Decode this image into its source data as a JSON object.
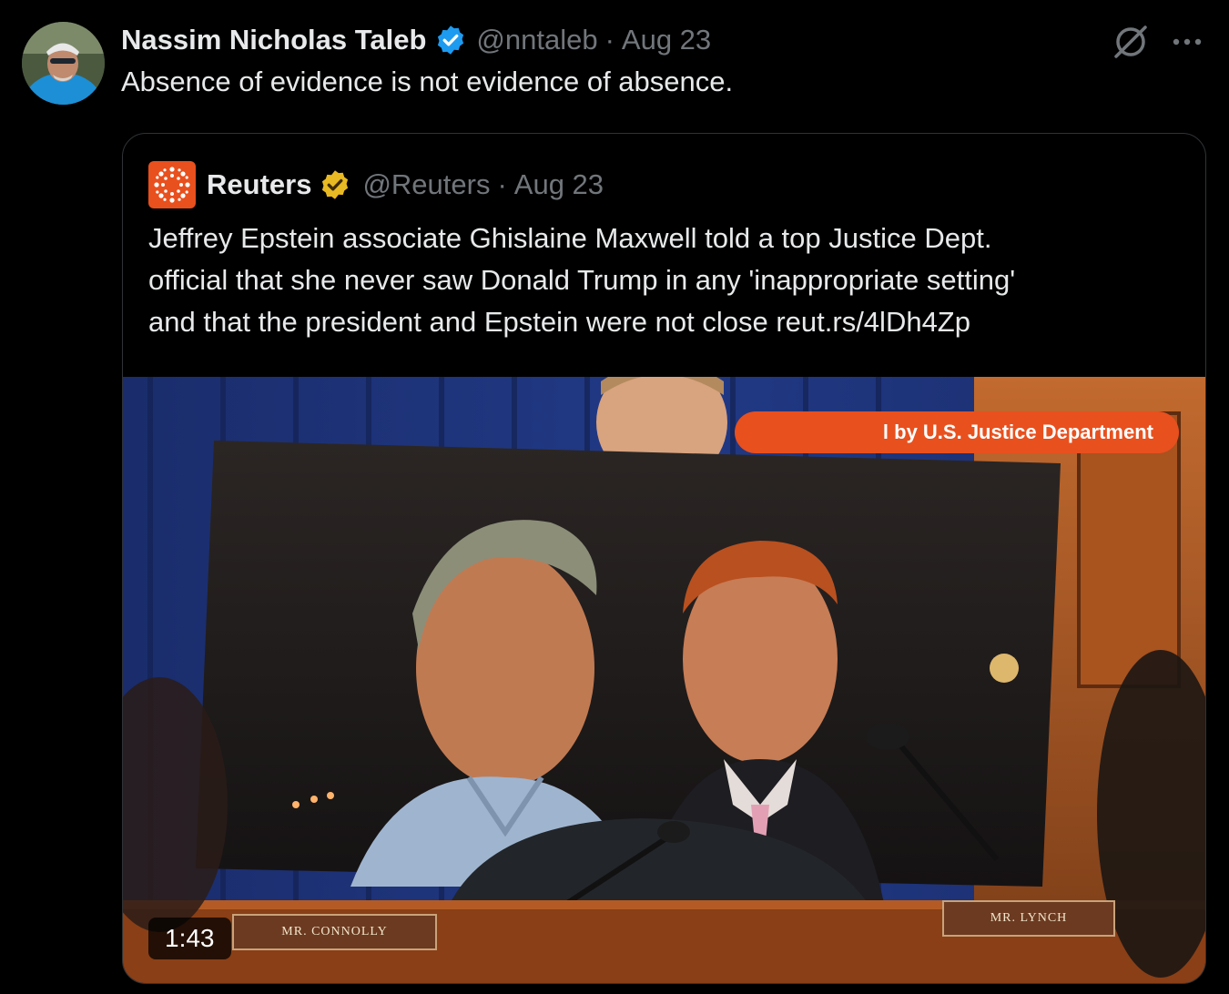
{
  "tweet": {
    "author_name": "Nassim Nicholas Taleb",
    "author_handle": "@nntaleb",
    "separator": "·",
    "date": "Aug 23",
    "text": "Absence of evidence is not evidence of absence.",
    "verified_badge_color": "#1d9bf0",
    "icons": [
      "grok-icon",
      "more-icon"
    ]
  },
  "quoted_tweet": {
    "author_name": "Reuters",
    "author_handle": "@Reuters",
    "separator": "·",
    "date": "Aug 23",
    "text_lines": [
      "Jeffrey Epstein associate Ghislaine Maxwell told a top Justice Dept.",
      "official that she never saw Donald Trump in any 'inappropriate setting'",
      "and that the president and Epstein were not close "
    ],
    "link": "reut.rs/4lDh4Zp",
    "logo_color": "#e8501e",
    "badge_color": "#e8b923",
    "media": {
      "overlay_caption": "l by U.S. Justice Department",
      "nameplate_left": "MR. CONNOLLY",
      "nameplate_right": "MR. LYNCH",
      "duration": "1:43"
    }
  }
}
